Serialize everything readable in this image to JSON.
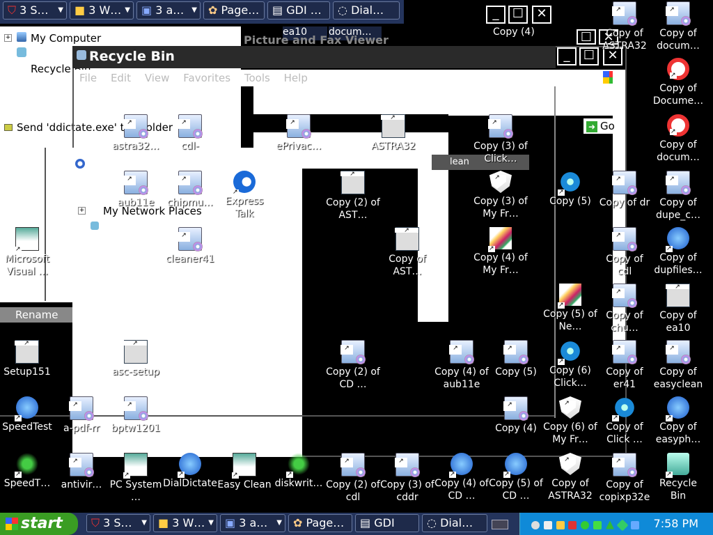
{
  "top_taskbar": {
    "buttons": [
      {
        "label": "3 S…",
        "icon": "shield-icon"
      },
      {
        "label": "3 W…",
        "icon": "folder-icon"
      },
      {
        "label": "3 a…",
        "icon": "app-icon"
      },
      {
        "label": "Page…",
        "icon": "page-icon"
      },
      {
        "label": "GDI …",
        "icon": "gdi-icon"
      },
      {
        "label": "Dial…",
        "icon": "dial-icon"
      }
    ]
  },
  "explorer_tree": {
    "items": [
      "My Computer",
      "Recycle Bin",
      "My Network Places"
    ],
    "context_items": [
      "Send 'ddictate.exe' to eFolder",
      "Rename"
    ]
  },
  "recycle_bin_window": {
    "title": "Recycle Bin",
    "menu": [
      "File",
      "Edit",
      "View",
      "Favorites",
      "Tools",
      "Help"
    ],
    "go_label": "Go"
  },
  "fragments": {
    "ea10": "ea10",
    "docum": "docum…",
    "copy4": "Copy (4)",
    "viewer_title": "Picture and Fax Viewer",
    "clean_text": "lean"
  },
  "desktop_icons": [
    {
      "label": "Copy of ASTRA32",
      "icon": "setup-icon"
    },
    {
      "label": "Copy of docum…",
      "icon": "disc-icon"
    },
    {
      "label": "Copy of Docume…",
      "icon": "lifebuoy-icon"
    },
    {
      "label": "Copy of docum…",
      "icon": "lifebuoy-icon"
    },
    {
      "label": "Copy of dupe_c…",
      "icon": "setup-icon"
    },
    {
      "label": "Copy of dupfiles…",
      "icon": "ring-arrow-icon"
    },
    {
      "label": "Copy of ea10",
      "icon": "window-icon"
    },
    {
      "label": "Copy of easyclean",
      "icon": "setup-icon"
    },
    {
      "label": "Copy of easyph…",
      "icon": "blue-c-icon"
    },
    {
      "label": "Recycle Bin",
      "icon": "recycle-bin-icon"
    },
    {
      "label": "Microsoft Visual …",
      "icon": "visual-icon"
    },
    {
      "label": "Setup151",
      "icon": "setup151-icon"
    },
    {
      "label": "SpeedTest",
      "icon": "speedtest-icon"
    },
    {
      "label": "SpeedT…",
      "icon": "pulse-icon"
    },
    {
      "label": "antivir…",
      "icon": "setup-icon"
    },
    {
      "label": "PC System …",
      "icon": "pc-icon"
    },
    {
      "label": "DialDictate",
      "icon": "dial-icon"
    },
    {
      "label": "Easy Clean",
      "icon": "easyclean-icon"
    },
    {
      "label": "diskwrit…",
      "icon": "disk-icon"
    },
    {
      "label": "Copy (2) of cdl",
      "icon": "setup-icon"
    },
    {
      "label": "Copy (3) of cddr",
      "icon": "setup-icon"
    },
    {
      "label": "Copy (4) of CD …",
      "icon": "blue-c-icon"
    },
    {
      "label": "Copy (5) of CD …",
      "icon": "blue-c-icon"
    },
    {
      "label": "Copy of ASTRA32",
      "icon": "shield-icon"
    },
    {
      "label": "Copy of copixp32e",
      "icon": "setup-icon"
    },
    {
      "label": "astra32…",
      "icon": "setup-icon"
    },
    {
      "label": "cdl-",
      "icon": "setup-icon"
    },
    {
      "label": "ePrivac…",
      "icon": "disc-icon"
    },
    {
      "label": "ASTRA32",
      "icon": "astra-icon"
    },
    {
      "label": "aub11e",
      "icon": "setup-icon"
    },
    {
      "label": "chipmu…",
      "icon": "setup-icon"
    },
    {
      "label": "Express Talk",
      "icon": "ie-icon"
    },
    {
      "label": "cleaner41",
      "icon": "setup-icon"
    },
    {
      "label": "asc-setup",
      "icon": "window-icon"
    },
    {
      "label": "a-pdf-rr",
      "icon": "setup-icon"
    },
    {
      "label": "bptw1201",
      "icon": "setup-icon"
    },
    {
      "label": "Copy (2) of AST…",
      "icon": "astra-icon"
    },
    {
      "label": "Copy of AST…",
      "icon": "astra-icon"
    },
    {
      "label": "Copy (3) of Click…",
      "icon": "setup-icon"
    },
    {
      "label": "Copy (3) of My Fr…",
      "icon": "shield-icon"
    },
    {
      "label": "Copy (5)",
      "icon": "gear-icon"
    },
    {
      "label": "Copy (4) of My Fr…",
      "icon": "feather-icon"
    },
    {
      "label": "Copy (5) of Ne…",
      "icon": "feather-icon"
    },
    {
      "label": "Copy (6) Click…",
      "icon": "gear-icon"
    },
    {
      "label": "Copy (2) of CD …",
      "icon": "setup-icon"
    },
    {
      "label": "Copy (4) of aub11e",
      "icon": "setup-icon"
    },
    {
      "label": "Copy (5)",
      "icon": "setup-icon"
    },
    {
      "label": "Copy (4)",
      "icon": "setup-icon"
    },
    {
      "label": "Copy (6) of My Fr…",
      "icon": "shield-icon"
    },
    {
      "label": "Copy of Click …",
      "icon": "gear-icon"
    },
    {
      "label": "Copy of cdl",
      "icon": "setup-icon"
    },
    {
      "label": "Copy of chu…",
      "icon": "setup-icon"
    },
    {
      "label": "Copy of er41",
      "icon": "setup-icon"
    },
    {
      "label": "Copy of dr",
      "icon": "setup-icon"
    }
  ],
  "bottom_taskbar": {
    "start_label": "start",
    "buttons": [
      {
        "label": "3 S…",
        "icon": "shield-icon"
      },
      {
        "label": "3 W…",
        "icon": "folder-icon"
      },
      {
        "label": "3 a…",
        "icon": "app-icon"
      },
      {
        "label": "Page…",
        "icon": "page-icon"
      },
      {
        "label": "GDI",
        "icon": "gdi-icon"
      },
      {
        "label": "Dial…",
        "icon": "dial-icon"
      }
    ],
    "clock": "7:58 PM"
  },
  "colors": {
    "taskbar": "#24345c",
    "start": "#3a9d23",
    "tray": "#0f8ad8"
  }
}
